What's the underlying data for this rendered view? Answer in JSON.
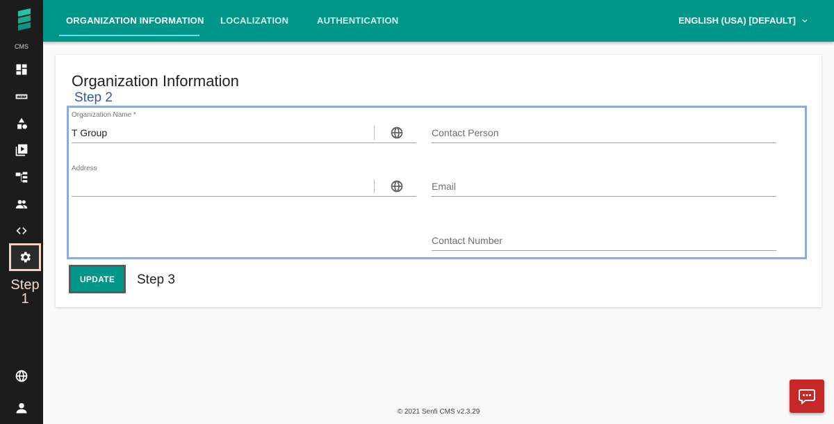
{
  "sidebar": {
    "cms_label": "CMS",
    "step_annotation": "Step\n1",
    "icons": [
      "dashboard-icon",
      "ruler-icon",
      "shapes-icon",
      "video-library-icon",
      "hierarchy-icon",
      "people-icon",
      "code-icon",
      "settings-icon",
      "globe-icon",
      "user-icon"
    ]
  },
  "topbar": {
    "tabs": [
      {
        "label": "ORGANIZATION INFORMATION",
        "active": true
      },
      {
        "label": "LOCALIZATION",
        "active": false
      },
      {
        "label": "AUTHENTICATION",
        "active": false
      }
    ],
    "language": "ENGLISH (USA) [DEFAULT]"
  },
  "card": {
    "title": "Organization Information",
    "step2_annotation": "Step 2",
    "step3_annotation": "Step 3",
    "fields": {
      "org_name": {
        "label": "Organization Name *",
        "value": "T Group"
      },
      "address": {
        "label": "Address",
        "value": ""
      },
      "contact_person": {
        "placeholder": "Contact Person"
      },
      "email": {
        "placeholder": "Email"
      },
      "contact_number": {
        "placeholder": "Contact Number"
      }
    },
    "update_label": "UPDATE"
  },
  "footer": {
    "text": "© 2021 Senfi CMS v2.3.29"
  },
  "colors": {
    "primary": "#00968a",
    "sidebar": "#1c1c1c",
    "annotation_box": "#8fa9dc",
    "chat": "#c62828"
  }
}
